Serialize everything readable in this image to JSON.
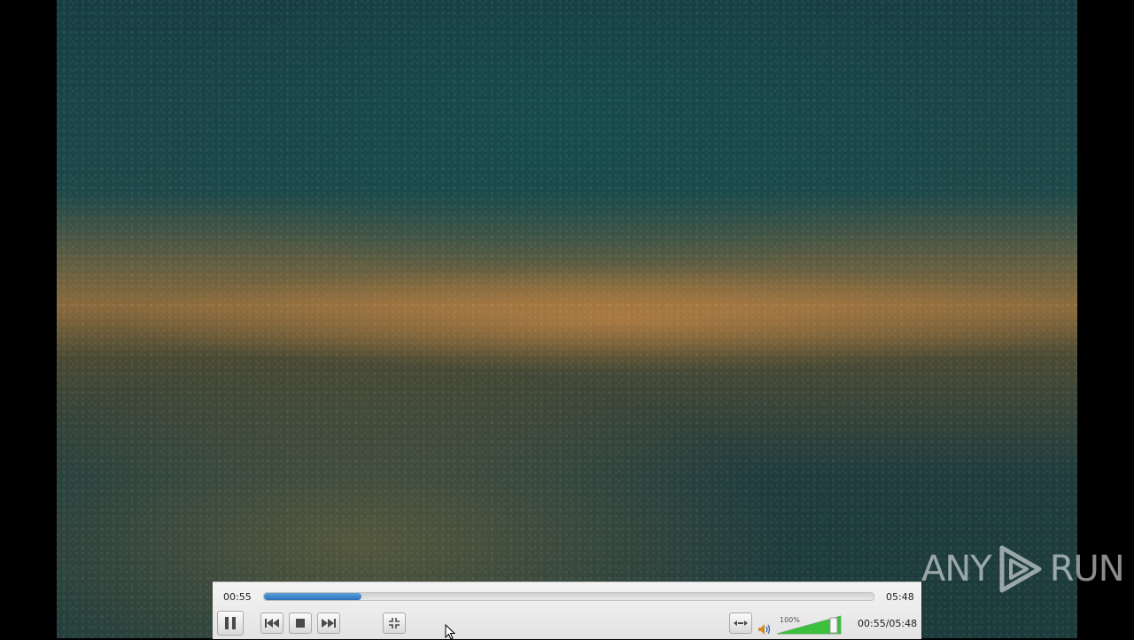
{
  "player": {
    "elapsed": "00:55",
    "total": "05:48",
    "position_label": "00:55/05:48",
    "progress": 0.16,
    "volume_label": "100%",
    "volume_level": 1.0
  },
  "icons": {
    "play_pause": "pause-icon",
    "previous": "previous-icon",
    "stop": "stop-icon",
    "next": "next-icon",
    "fullscreen": "fullscreen-exit-icon",
    "playlist_toggle": "extended-settings-icon",
    "volume": "speaker-icon"
  },
  "colors": {
    "progress": "#3a82c8",
    "volume": "#3cbf3c"
  },
  "watermark": {
    "text_left": "ANY",
    "text_right": "RUN"
  }
}
